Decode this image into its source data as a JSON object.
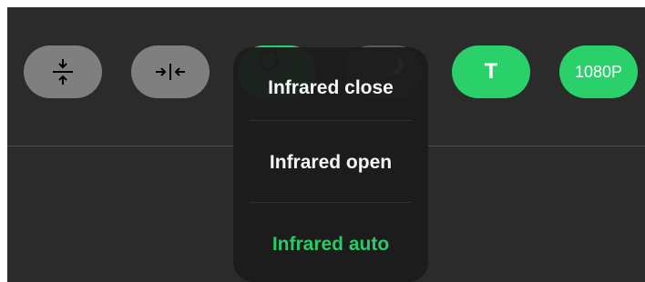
{
  "toolbar": {
    "buttons": [
      {
        "name": "compress-vertical",
        "icon": "compress-vertical-icon",
        "style": "gray"
      },
      {
        "name": "compress-horizontal",
        "icon": "compress-horizontal-icon",
        "style": "gray"
      },
      {
        "name": "infrared",
        "icon": "light-bulb-icon",
        "style": "green"
      },
      {
        "name": "night-mode",
        "icon": "moon-icon",
        "style": "dark"
      },
      {
        "name": "text",
        "label": "T",
        "style": "green"
      },
      {
        "name": "resolution",
        "label": "1080P",
        "style": "green"
      }
    ]
  },
  "infrared_menu": {
    "items": [
      {
        "label": "Infrared close",
        "selected": false
      },
      {
        "label": "Infrared open",
        "selected": false
      },
      {
        "label": "Infrared auto",
        "selected": true
      }
    ]
  },
  "colors": {
    "accent_green": "#2ad16a",
    "button_gray": "#7f7f7f",
    "background": "#2b2b2b",
    "popup": "#1c1c1c"
  }
}
